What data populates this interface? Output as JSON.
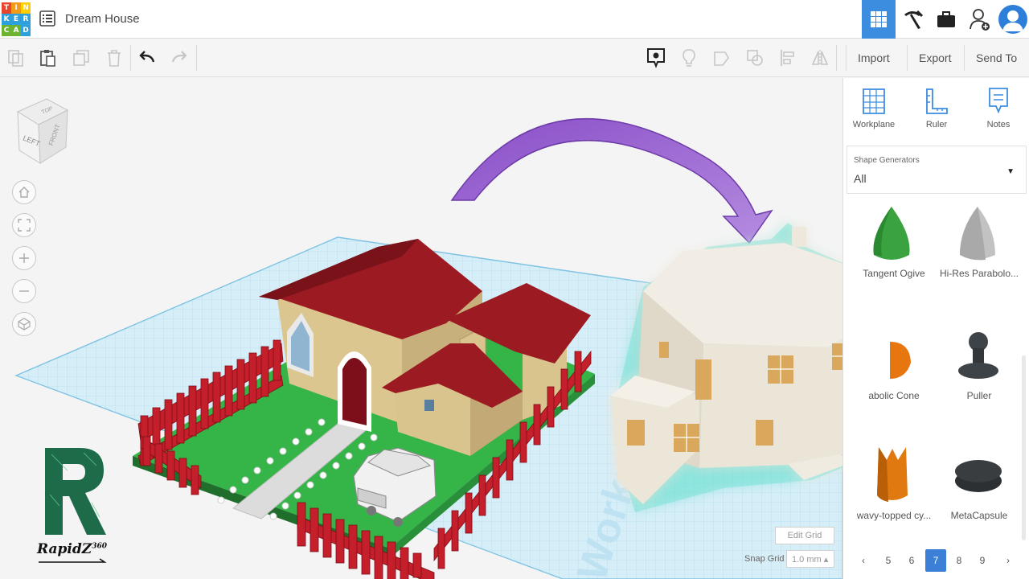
{
  "app": {
    "logo_letters": [
      "T",
      "I",
      "N",
      "K",
      "E",
      "R",
      "C",
      "A",
      "D"
    ],
    "logo_colors": [
      "#e8452c",
      "#f49a1a",
      "#ffcd00",
      "#2ea0db",
      "#2ea0db",
      "#2ea0db",
      "#6bb330",
      "#6bb330",
      "#2ea0db"
    ],
    "document_title": "Dream House"
  },
  "topbar": {
    "buttons": [
      "grid-view",
      "build-tools",
      "briefcase",
      "add-user",
      "profile"
    ],
    "accent": "#3c8ce0"
  },
  "toolbar": {
    "import_label": "Import",
    "export_label": "Export",
    "send_to_label": "Send To"
  },
  "viewport": {
    "viewcube_top": "TOP",
    "viewcube_left": "LEFT",
    "viewcube_front": "FRONT",
    "edit_grid_label": "Edit Grid",
    "snap_grid_label": "Snap Grid",
    "snap_grid_value": "1.0 mm ▴",
    "workplane_watermark": "Workplane",
    "logo_text": "RapidZ",
    "logo_superscript": "360"
  },
  "panel": {
    "tools": [
      {
        "label": "Workplane"
      },
      {
        "label": "Ruler"
      },
      {
        "label": "Notes"
      }
    ],
    "shape_generators_label": "Shape Generators",
    "shape_generators_value": "All",
    "shapes": [
      {
        "label": "Tangent Ogive",
        "color": "#3aa33f"
      },
      {
        "label": "Hi-Res Parabolo...",
        "color": "#b9b9b9"
      },
      {
        "label": "abolic Cone",
        "color": "#e8760f"
      },
      {
        "label": "Puller",
        "color": "#3e4347"
      },
      {
        "label": "wavy-topped cy...",
        "color": "#e07a10"
      },
      {
        "label": "MetaCapsule",
        "color": "#3a3d40"
      }
    ],
    "pages": [
      "‹",
      "5",
      "6",
      "7",
      "8",
      "9",
      "›"
    ],
    "active_page": "7"
  }
}
